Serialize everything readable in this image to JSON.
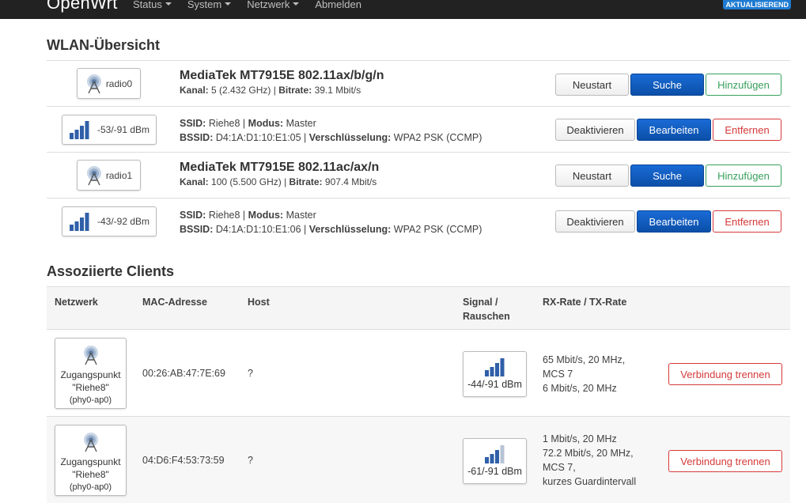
{
  "nav": {
    "brand": "OpenWrt",
    "menu": [
      {
        "label": "Status",
        "dropdown": true
      },
      {
        "label": "System",
        "dropdown": true
      },
      {
        "label": "Netzwerk",
        "dropdown": true
      },
      {
        "label": "Abmelden",
        "dropdown": false
      }
    ],
    "badge": "AKTUALISIEREND"
  },
  "wifi_overview": {
    "title": "WLAN-Übersicht",
    "radio0": {
      "badge": "radio0",
      "title": "MediaTek MT7915E 802.11ax/b/g/n",
      "k_kanal": "Kanal:",
      "kanal": "5 (2.432 GHz)",
      "k_bitrate": "Bitrate:",
      "bitrate": "39.1 Mbit/s",
      "btn_restart": "Neustart",
      "btn_scan": "Suche",
      "btn_add": "Hinzufügen"
    },
    "net0": {
      "signal": "-53/-91 dBm",
      "k_ssid": "SSID:",
      "ssid": "Riehe8",
      "k_modus": "Modus:",
      "modus": "Master",
      "k_bssid": "BSSID:",
      "bssid": "D4:1A:D1:10:E1:05",
      "k_enc": "Verschlüsselung:",
      "enc": "WPA2 PSK (CCMP)",
      "btn_disable": "Deaktivieren",
      "btn_edit": "Bearbeiten",
      "btn_remove": "Entfernen"
    },
    "radio1": {
      "badge": "radio1",
      "title": "MediaTek MT7915E 802.11ac/ax/n",
      "k_kanal": "Kanal:",
      "kanal": "100 (5.500 GHz)",
      "k_bitrate": "Bitrate:",
      "bitrate": "907.4 Mbit/s",
      "btn_restart": "Neustart",
      "btn_scan": "Suche",
      "btn_add": "Hinzufügen"
    },
    "net1": {
      "signal": "-43/-92 dBm",
      "k_ssid": "SSID:",
      "ssid": "Riehe8",
      "k_modus": "Modus:",
      "modus": "Master",
      "k_bssid": "BSSID:",
      "bssid": "D4:1A:D1:10:E1:06",
      "k_enc": "Verschlüsselung:",
      "enc": "WPA2 PSK (CCMP)",
      "btn_disable": "Deaktivieren",
      "btn_edit": "Bearbeiten",
      "btn_remove": "Entfernen"
    }
  },
  "clients": {
    "title": "Assoziierte Clients",
    "headers": {
      "network": "Netzwerk",
      "mac": "MAC-Adresse",
      "host": "Host",
      "signal_l1": "Signal /",
      "signal_l2": "Rauschen",
      "rate": "RX-Rate / TX-Rate"
    },
    "rows": [
      {
        "ap_l1": "Zugangspunkt",
        "ap_l2": "\"Riehe8\"",
        "ap_l3": "(phy0-ap0)",
        "mac": "00:26:AB:47:7E:69",
        "host": "?",
        "signal": "-44/-91 dBm",
        "rate_l1": "65 Mbit/s, 20 MHz,",
        "rate_l2": "MCS 7",
        "rate_l3": "6 Mbit/s, 20 MHz",
        "rate_l4": "",
        "btn": "Verbindung trennen"
      },
      {
        "ap_l1": "Zugangspunkt",
        "ap_l2": "\"Riehe8\"",
        "ap_l3": "(phy0-ap0)",
        "mac": "04:D6:F4:53:73:59",
        "host": "?",
        "signal": "-61/-91 dBm",
        "rate_l1": "1 Mbit/s, 20 MHz",
        "rate_l2": "72.2 Mbit/s, 20 MHz,",
        "rate_l3": "MCS 7,",
        "rate_l4": "kurzes Guardintervall",
        "btn": "Verbindung trennen"
      }
    ]
  },
  "colors": {
    "navbar": "#222222",
    "primary": "#0b4fa8",
    "positive": "#37a05b",
    "negative": "#d63a3a",
    "badge": "#1e7bd1"
  }
}
